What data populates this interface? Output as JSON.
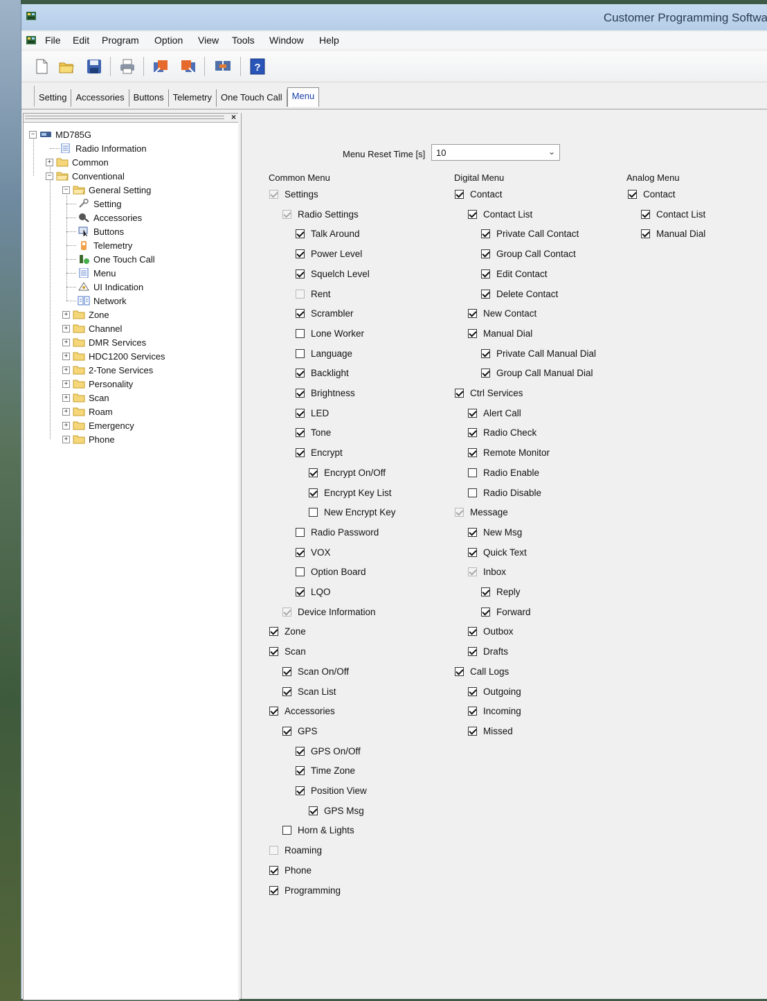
{
  "window": {
    "title": "Customer Programming Softwa"
  },
  "menubar": [
    "File",
    "Edit",
    "Program",
    "Option",
    "View",
    "Tools",
    "Window",
    "Help"
  ],
  "toolbar": [
    "new-file-icon",
    "open-folder-icon",
    "save-icon",
    "print-icon",
    "read-radio-icon",
    "write-radio-icon",
    "clone-icon",
    "help-icon"
  ],
  "tabs": [
    "Setting",
    "Accessories",
    "Buttons",
    "Telemetry",
    "One Touch Call",
    "Menu"
  ],
  "tree": {
    "root": "MD785G",
    "radio_information": "Radio Information",
    "common": "Common",
    "conventional": "Conventional",
    "general_setting": "General Setting",
    "general_children": [
      "Setting",
      "Accessories",
      "Buttons",
      "Telemetry",
      "One Touch Call",
      "Menu",
      "UI Indication",
      "Network"
    ],
    "folders": [
      "Zone",
      "Channel",
      "DMR Services",
      "HDC1200 Services",
      "2-Tone Services",
      "Personality",
      "Scan",
      "Roam",
      "Emergency",
      "Phone"
    ]
  },
  "menu_reset": {
    "label": "Menu Reset Time [s]",
    "value": "10"
  },
  "sections": {
    "common": "Common Menu",
    "digital": "Digital Menu",
    "analog": "Analog Menu"
  },
  "common_menu": [
    {
      "label": "Settings",
      "level": 0,
      "checked": true,
      "disabled": true
    },
    {
      "label": "Radio Settings",
      "level": 1,
      "checked": true,
      "disabled": true
    },
    {
      "label": "Talk Around",
      "level": 2,
      "checked": true,
      "disabled": false
    },
    {
      "label": "Power Level",
      "level": 2,
      "checked": true,
      "disabled": false
    },
    {
      "label": "Squelch Level",
      "level": 2,
      "checked": true,
      "disabled": false
    },
    {
      "label": "Rent",
      "level": 2,
      "checked": false,
      "disabled": true
    },
    {
      "label": "Scrambler",
      "level": 2,
      "checked": true,
      "disabled": false
    },
    {
      "label": "Lone Worker",
      "level": 2,
      "checked": false,
      "disabled": false
    },
    {
      "label": "Language",
      "level": 2,
      "checked": false,
      "disabled": false
    },
    {
      "label": "Backlight",
      "level": 2,
      "checked": true,
      "disabled": false
    },
    {
      "label": "Brightness",
      "level": 2,
      "checked": true,
      "disabled": false
    },
    {
      "label": "LED",
      "level": 2,
      "checked": true,
      "disabled": false
    },
    {
      "label": "Tone",
      "level": 2,
      "checked": true,
      "disabled": false
    },
    {
      "label": "Encrypt",
      "level": 2,
      "checked": true,
      "disabled": false
    },
    {
      "label": "Encrypt On/Off",
      "level": 3,
      "checked": true,
      "disabled": false
    },
    {
      "label": "Encrypt Key List",
      "level": 3,
      "checked": true,
      "disabled": false
    },
    {
      "label": "New Encrypt Key",
      "level": 3,
      "checked": false,
      "disabled": false
    },
    {
      "label": "Radio Password",
      "level": 2,
      "checked": false,
      "disabled": false
    },
    {
      "label": "VOX",
      "level": 2,
      "checked": true,
      "disabled": false
    },
    {
      "label": "Option Board",
      "level": 2,
      "checked": false,
      "disabled": false
    },
    {
      "label": "LQO",
      "level": 2,
      "checked": true,
      "disabled": false
    },
    {
      "label": "Device Information",
      "level": 1,
      "checked": true,
      "disabled": true
    },
    {
      "label": "Zone",
      "level": 0,
      "checked": true,
      "disabled": false
    },
    {
      "label": "Scan",
      "level": 0,
      "checked": true,
      "disabled": false
    },
    {
      "label": "Scan On/Off",
      "level": 1,
      "checked": true,
      "disabled": false
    },
    {
      "label": "Scan List",
      "level": 1,
      "checked": true,
      "disabled": false
    },
    {
      "label": "Accessories",
      "level": 0,
      "checked": true,
      "disabled": false
    },
    {
      "label": "GPS",
      "level": 1,
      "checked": true,
      "disabled": false
    },
    {
      "label": "GPS On/Off",
      "level": 2,
      "checked": true,
      "disabled": false
    },
    {
      "label": "Time Zone",
      "level": 2,
      "checked": true,
      "disabled": false
    },
    {
      "label": "Position View",
      "level": 2,
      "checked": true,
      "disabled": false
    },
    {
      "label": "GPS Msg",
      "level": 3,
      "checked": true,
      "disabled": false
    },
    {
      "label": "Horn & Lights",
      "level": 1,
      "checked": false,
      "disabled": false
    },
    {
      "label": "Roaming",
      "level": 0,
      "checked": false,
      "disabled": true
    },
    {
      "label": "Phone",
      "level": 0,
      "checked": true,
      "disabled": false
    },
    {
      "label": "Programming",
      "level": 0,
      "checked": true,
      "disabled": false
    }
  ],
  "digital_menu": [
    {
      "label": "Contact",
      "level": 0,
      "checked": true,
      "disabled": false
    },
    {
      "label": "Contact List",
      "level": 1,
      "checked": true,
      "disabled": false
    },
    {
      "label": "Private Call Contact",
      "level": 2,
      "checked": true,
      "disabled": false
    },
    {
      "label": "Group Call Contact",
      "level": 2,
      "checked": true,
      "disabled": false
    },
    {
      "label": "Edit Contact",
      "level": 2,
      "checked": true,
      "disabled": false
    },
    {
      "label": "Delete Contact",
      "level": 2,
      "checked": true,
      "disabled": false
    },
    {
      "label": "New Contact",
      "level": 1,
      "checked": true,
      "disabled": false
    },
    {
      "label": "Manual Dial",
      "level": 1,
      "checked": true,
      "disabled": false
    },
    {
      "label": "Private Call Manual Dial",
      "level": 2,
      "checked": true,
      "disabled": false
    },
    {
      "label": "Group Call Manual Dial",
      "level": 2,
      "checked": true,
      "disabled": false
    },
    {
      "label": "Ctrl Services",
      "level": 0,
      "checked": true,
      "disabled": false
    },
    {
      "label": "Alert Call",
      "level": 1,
      "checked": true,
      "disabled": false
    },
    {
      "label": "Radio Check",
      "level": 1,
      "checked": true,
      "disabled": false
    },
    {
      "label": "Remote Monitor",
      "level": 1,
      "checked": true,
      "disabled": false
    },
    {
      "label": "Radio Enable",
      "level": 1,
      "checked": false,
      "disabled": false
    },
    {
      "label": "Radio Disable",
      "level": 1,
      "checked": false,
      "disabled": false
    },
    {
      "label": "Message",
      "level": 0,
      "checked": true,
      "disabled": true
    },
    {
      "label": "New Msg",
      "level": 1,
      "checked": true,
      "disabled": false
    },
    {
      "label": "Quick Text",
      "level": 1,
      "checked": true,
      "disabled": false
    },
    {
      "label": "Inbox",
      "level": 1,
      "checked": true,
      "disabled": true
    },
    {
      "label": "Reply",
      "level": 2,
      "checked": true,
      "disabled": false
    },
    {
      "label": "Forward",
      "level": 2,
      "checked": true,
      "disabled": false
    },
    {
      "label": "Outbox",
      "level": 1,
      "checked": true,
      "disabled": false
    },
    {
      "label": "Drafts",
      "level": 1,
      "checked": true,
      "disabled": false
    },
    {
      "label": "Call Logs",
      "level": 0,
      "checked": true,
      "disabled": false
    },
    {
      "label": "Outgoing",
      "level": 1,
      "checked": true,
      "disabled": false
    },
    {
      "label": "Incoming",
      "level": 1,
      "checked": true,
      "disabled": false
    },
    {
      "label": "Missed",
      "level": 1,
      "checked": true,
      "disabled": false
    }
  ],
  "analog_menu": [
    {
      "label": "Contact",
      "level": 0,
      "checked": true,
      "disabled": false
    },
    {
      "label": "Contact List",
      "level": 1,
      "checked": true,
      "disabled": false
    },
    {
      "label": "Manual Dial",
      "level": 1,
      "checked": true,
      "disabled": false
    }
  ]
}
